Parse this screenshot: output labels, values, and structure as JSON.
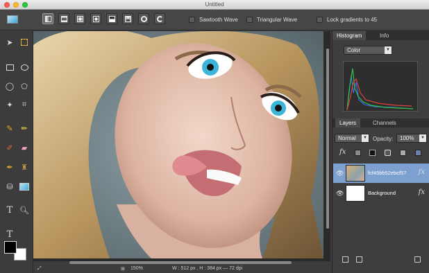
{
  "window": {
    "title": "Untitled"
  },
  "options_bar": {
    "tool_icon": "gradient-swatch-icon",
    "gradient_modes": [
      "linear-icon",
      "reflected-icon",
      "diamond-icon",
      "radial-icon",
      "square-icon",
      "cone-icon",
      "spiral-icon",
      "spiral-alt-icon"
    ],
    "checkboxes": [
      {
        "label": "Sawtooth Wave",
        "checked": false
      },
      {
        "label": "Triangular Wave",
        "checked": false
      },
      {
        "label": "Lock gradients to 45",
        "checked": false
      }
    ]
  },
  "tools": [
    "move-icon",
    "marquee-icon",
    "rect-select-icon",
    "ellipse-select-icon",
    "lasso-icon",
    "poly-lasso-icon",
    "magic-wand-icon",
    "crop-icon",
    "brush-icon",
    "pencil-icon",
    "clone-stamp-icon",
    "eraser-icon",
    "eyedropper-icon",
    "stamp-icon",
    "paint-bucket-icon",
    "gradient-tool-icon",
    "type-icon",
    "zoom-icon",
    "text-alt-icon"
  ],
  "colors": {
    "foreground": "#000000",
    "background": "#ffffff",
    "selection": "#7ca0cf",
    "panel": "#3e3e3e"
  },
  "status": {
    "zoom": "150%",
    "dimensions": "W : 512 px , H : 384 px — 72 dpi"
  },
  "histogram_panel": {
    "tabs": [
      {
        "label": "Histogram",
        "active": true
      },
      {
        "label": "Info",
        "active": false
      }
    ],
    "channel": "Color"
  },
  "layers_panel": {
    "tabs": [
      {
        "label": "Layers",
        "active": true
      },
      {
        "label": "Channels",
        "active": false
      }
    ],
    "blend_mode": "Normal",
    "opacity_label": "Opacity:",
    "opacity_value": "100%",
    "fx": "fx",
    "layers": [
      {
        "name": "fcf45bb52ebcf57",
        "selected": true,
        "thumb": "portrait"
      },
      {
        "name": "Background",
        "selected": false,
        "thumb": "white"
      }
    ]
  }
}
